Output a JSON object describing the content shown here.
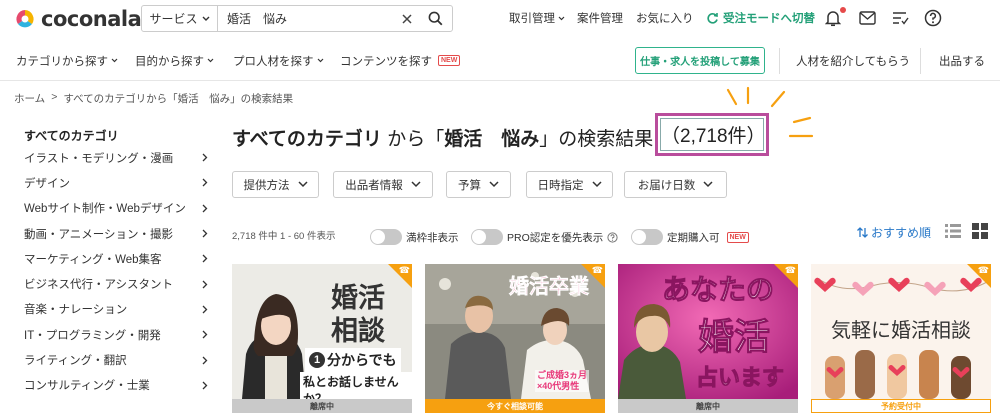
{
  "header": {
    "logo_text": "coconala",
    "search": {
      "category": "サービス",
      "value": "婚活　悩み"
    },
    "nav": [
      "取引管理",
      "案件管理",
      "お気に入り"
    ],
    "mode_switch": "受注モードへ切替"
  },
  "nav2": {
    "items": [
      "カテゴリから探す",
      "目的から探す",
      "プロ人材を探す",
      "コンテンツを探す"
    ],
    "new_badge": "NEW",
    "post_button": "仕事・求人を投稿して募集",
    "refer": "人材を紹介してもらう",
    "sell": "出品する"
  },
  "breadcrumb": {
    "home": "ホーム",
    "sep": ">",
    "current": "すべてのカテゴリから「婚活　悩み」の検索結果"
  },
  "sidebar": {
    "heading": "すべてのカテゴリ",
    "items": [
      "イラスト・モデリング・漫画",
      "デザイン",
      "Webサイト制作・Webデザイン",
      "動画・アニメーション・撮影",
      "マーケティング・Web集客",
      "ビジネス代行・アシスタント",
      "音楽・ナレーション",
      "IT・プログラミング・開発",
      "ライティング・翻訳",
      "コンサルティング・士業"
    ]
  },
  "title": {
    "category": "すべてのカテゴリ",
    "from": " から「",
    "keyword": "婚活　悩み",
    "suffix": "」の検索結果",
    "count": "（2,718件）"
  },
  "filters": [
    "提供方法",
    "出品者情報",
    "予算",
    "日時指定",
    "お届け日数"
  ],
  "results": {
    "meta": "2,718 件中 1 - 60 件表示",
    "toggles": [
      "満枠非表示",
      "PRO認定を優先表示",
      "定期購入可"
    ],
    "new_badge": "NEW",
    "sort": "おすすめ順"
  },
  "cards": [
    {
      "line1": "婚活",
      "line2": "相談",
      "line3": "分からでも",
      "num": "1",
      "line4": "私とお話しませんか？",
      "status": "離席中"
    },
    {
      "line1": "婚活卒業",
      "line2": "ご成婚3ヵ月",
      "line3": "×40代男性",
      "status": "今すぐ相談可能"
    },
    {
      "line1": "あなたの",
      "line2": "婚活",
      "line3": "占います",
      "status": "離席中"
    },
    {
      "line1": "気軽に婚活相談",
      "status": "予約受付中"
    }
  ],
  "colors": {
    "accent": "#23a078",
    "highlight": "#b94d9c",
    "orange": "#f6a010",
    "link": "#2878c8"
  }
}
